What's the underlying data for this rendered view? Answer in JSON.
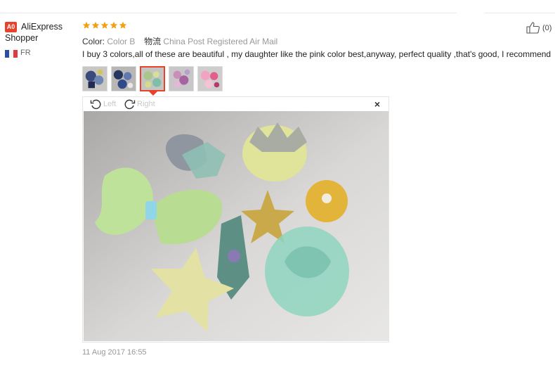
{
  "reviewer": {
    "avatar_initials": "A0",
    "name": "AliExpress Shopper",
    "country": "FR"
  },
  "rating": {
    "value": 5,
    "max": 5,
    "star_color": "#f2a114"
  },
  "review_meta": {
    "color_key": "Color:",
    "color_value": "Color B",
    "shipping_key": "物流",
    "shipping_value": "China Post Registered Air Mail"
  },
  "review_text": "I buy 3 colors,all of these are beautiful , my daughter like the pink color best,anyway, perfect quality ,that's good, I recommend",
  "helpful": {
    "count": "(0)",
    "icon": "thumbs-up-icon"
  },
  "thumbnails": [
    {
      "name": "thumbnail-1",
      "active": false
    },
    {
      "name": "thumbnail-2",
      "active": false
    },
    {
      "name": "thumbnail-3",
      "active": true
    },
    {
      "name": "thumbnail-4",
      "active": false
    },
    {
      "name": "thumbnail-5",
      "active": false
    }
  ],
  "viewer": {
    "rotate_left_label": "Left",
    "rotate_right_label": "Right",
    "close_label": "×"
  },
  "date": "11 Aug 2017 16:55",
  "colors": {
    "accent": "#e6422c",
    "muted": "#999999"
  }
}
